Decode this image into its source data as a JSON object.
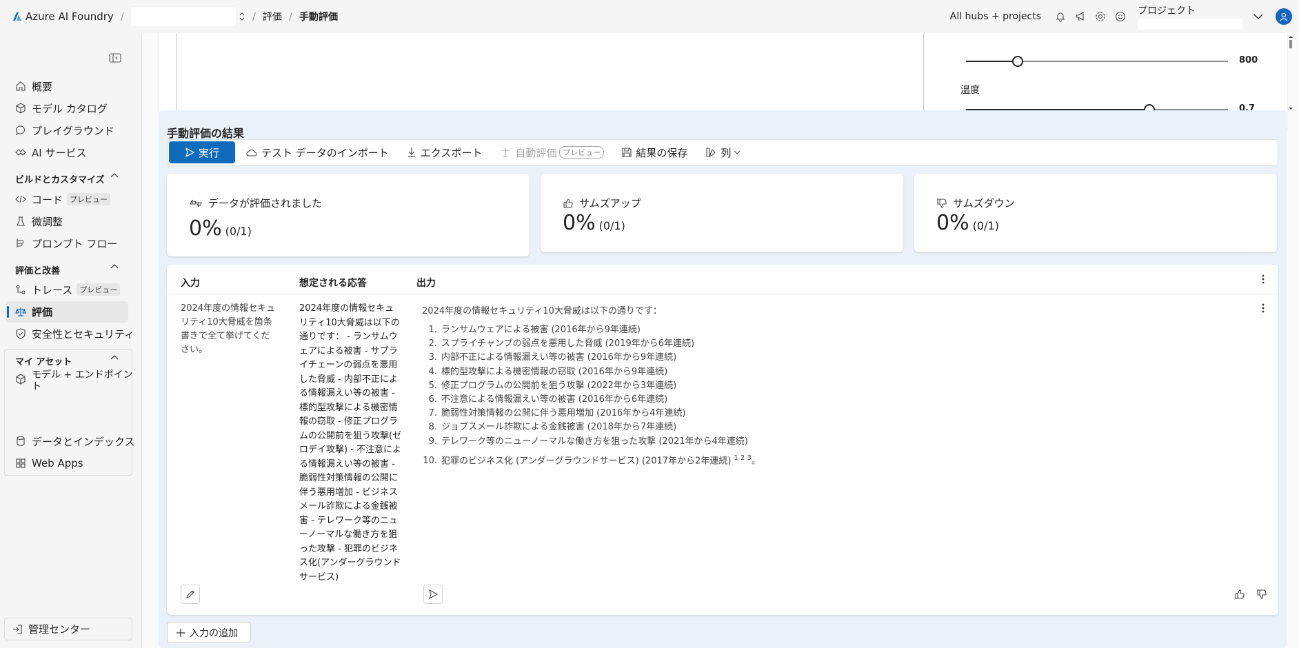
{
  "topbar": {
    "brand": "Azure AI Foundry",
    "sep": "/",
    "crumb_eval": "評価",
    "crumb_manual": "手動評価",
    "hubs": "All hubs + projects",
    "project_label": "プロジェクト"
  },
  "sidebar": {
    "items": {
      "overview": "概要",
      "model_catalog": "モデル カタログ",
      "playground": "プレイグラウンド",
      "ai_services": "AI サービス",
      "code": "コード",
      "finetune": "微調整",
      "prompt_flow": "プロンプト フロー",
      "trace": "トレース",
      "evaluation": "評価",
      "safety": "安全性とセキュリティ",
      "models_endpoints": "モデル + エンドポイント",
      "data_indexes": "データとインデックス",
      "web_apps": "Web Apps"
    },
    "sections": {
      "build": "ビルドとカスタマイズ",
      "assess": "評価と改善",
      "my_assets": "マイ アセット"
    },
    "preview_badge": "プレビュー",
    "management": "管理センター"
  },
  "params": {
    "top_value": "800",
    "temperature_label": "温度",
    "temperature_value": "0.7",
    "temperature_fraction": 0.7
  },
  "results": {
    "title": "手動評価の結果",
    "toolbar": {
      "run": "実行",
      "import": "テスト データのインポート",
      "export": "エクスポート",
      "auto_eval": "自動評価",
      "auto_eval_badge": "プレビュー",
      "save": "結果の保存",
      "columns": "列"
    },
    "stats": [
      {
        "label": "データが評価されました",
        "value": "0%",
        "fraction": "(0/1)"
      },
      {
        "label": "サムズアップ",
        "value": "0%",
        "fraction": "(0/1)"
      },
      {
        "label": "サムズダウン",
        "value": "0%",
        "fraction": "(0/1)"
      }
    ],
    "table": {
      "headers": [
        "入力",
        "想定される応答",
        "出力"
      ],
      "input": "2024年度の情報セキュリティ10大脅威を箇条書きで全て挙げてください。",
      "expected": "2024年度の情報セキュリティ10大脅威は以下の通りです： - ランサムウェアによる被害 - サプライチェーンの弱点を悪用した脅威 - 内部不正による情報漏えい等の被害 - 標的型攻撃による機密情報の窃取 - 修正プログラムの公開前を狙う攻撃(ゼロデイ攻撃) - 不注意による情報漏えい等の被害 - 脆弱性対策情報の公開に伴う悪用増加 - ビジネスメール詐欺による金銭被害 - テレワーク等のニューノーマルな働き方を狙った攻撃 - 犯罪のビジネス化(アンダーグラウンドサービス)",
      "output_intro": "2024年度の情報セキュリティ10大脅威は以下の通りです：",
      "output_items": [
        "ランサムウェアによる被害 (2016年から9年連続)",
        "スプライチャンプの弱点を悪用した脅威 (2019年から6年連続)",
        "内部不正による情報漏えい等の被害 (2016年から9年連続)",
        "標的型攻撃による機密情報の窃取 (2016年から9年連続)",
        "修正プログラムの公開前を狙う攻撃 (2022年から3年連続)",
        "不注意による情報漏えい等の被害 (2016年から6年連続)",
        "脆弱性対策情報の公開に伴う悪用増加 (2016年から4年連続)",
        "ジョブスメール詐欺による金銭被害 (2018年から7年連続)",
        "テレワーク等のニューノーマルな働き方を狙った攻撃 (2021年から4年連続)",
        "犯罪のビジネス化 (アンダーグラウンドサービス) (2017年から2年連続)"
      ],
      "output_refs": "1 2 3",
      "output_end": "。"
    },
    "add_input": "入力の追加"
  }
}
